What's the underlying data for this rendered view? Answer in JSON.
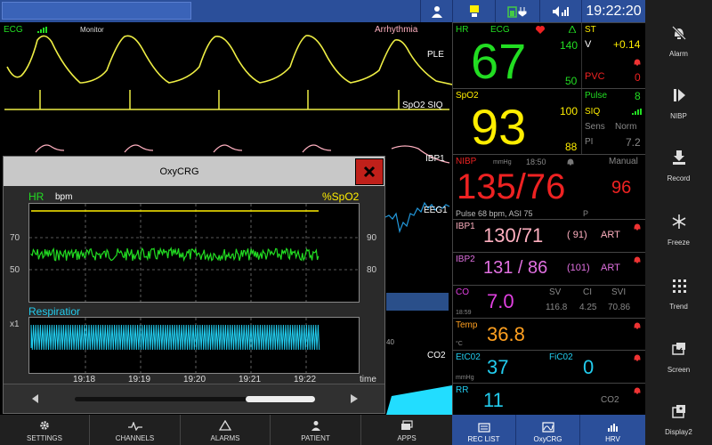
{
  "status": {
    "clock": "19:22:20"
  },
  "waves": {
    "ecg_label": "ECG",
    "monitor_label": "Monitor",
    "arrhythmia_label": "Arrhythmia",
    "ple_label": "PLE",
    "spo2_siq_label": "SpO2 SIQ",
    "ibp1_label": "IBP1",
    "eeg_label": "EEG1",
    "co2_label": "CO2",
    "partial_scale": "40"
  },
  "params": {
    "hr": {
      "label": "HR",
      "source": "ECG",
      "value": "67",
      "upper": "140",
      "lower": "50"
    },
    "st": {
      "label": "ST",
      "lead": "V",
      "value": "+0.14",
      "pvc_label": "PVC",
      "pvc_value": "0"
    },
    "spo2": {
      "label": "SpO2",
      "value": "93",
      "upper": "100",
      "lower": "88",
      "pulse_label": "Pulse",
      "pulse_value": "8",
      "siq_label": "SIQ",
      "sens_label": "Sens",
      "sens_value": "Norm",
      "pi_label": "PI",
      "pi_value": "7.2"
    },
    "nibp": {
      "label": "NIBP",
      "unit": "mmHg",
      "time": "18:50",
      "mode": "Manual",
      "value": "135/76",
      "mean": "96",
      "pulse_line": "Pulse 68 bpm, ASI 75",
      "p_label": "P"
    },
    "ibp1": {
      "label": "IBP1",
      "value": "130/71",
      "mean": "( 91)",
      "site": "ART"
    },
    "ibp2": {
      "label": "IBP2",
      "value": "131 / 86",
      "mean": "(101)",
      "site": "ART"
    },
    "co": {
      "label": "CO",
      "time": "18:59",
      "value": "7.0",
      "sv_label": "SV",
      "sv_value": "116.8",
      "ci_label": "CI",
      "ci_value": "4.25",
      "svi_label": "SVI",
      "svi_value": "70.86"
    },
    "temp": {
      "label": "Temp",
      "unit": "°C",
      "value": "36.8"
    },
    "etco2": {
      "label": "EtC02",
      "unit": "mmHg",
      "value": "37",
      "fico2_label": "FiC02",
      "fico2_value": "0"
    },
    "rr": {
      "label": "RR",
      "value": "11",
      "co2_label": "CO2"
    }
  },
  "popup": {
    "title": "OxyCRG",
    "hr_label": "HR",
    "unit_label": "bpm",
    "spo2_label": "%SpO2",
    "hr_ticks": [
      "70",
      "50"
    ],
    "spo2_ticks": [
      "90",
      "80"
    ],
    "resp_label": "Respiratior",
    "x1_label": "x1",
    "time_ticks": [
      "19:18",
      "19:19",
      "19:20",
      "19:21",
      "19:22"
    ],
    "time_label": "time"
  },
  "sidebar": [
    {
      "name": "alarm",
      "label": "Alarm",
      "icon": "bell-off-icon"
    },
    {
      "name": "nibp",
      "label": "NIBP",
      "icon": "play-bar-icon"
    },
    {
      "name": "record",
      "label": "Record",
      "icon": "download-icon"
    },
    {
      "name": "freeze",
      "label": "Freeze",
      "icon": "snowflake-icon"
    },
    {
      "name": "trend",
      "label": "Trend",
      "icon": "grid-dots-icon"
    },
    {
      "name": "screen",
      "label": "Screen",
      "icon": "screen-icon"
    },
    {
      "name": "display2",
      "label": "Display2",
      "icon": "display-icon"
    }
  ],
  "bottom": [
    {
      "name": "settings",
      "label": "SETTINGS",
      "icon": "gear-icon"
    },
    {
      "name": "channels",
      "label": "CHANNELS",
      "icon": "waveform-icon"
    },
    {
      "name": "alarms",
      "label": "ALARMS",
      "icon": "alarm-triangle-icon"
    },
    {
      "name": "patient",
      "label": "PATIENT",
      "icon": "person-icon"
    },
    {
      "name": "apps",
      "label": "APPS",
      "icon": "apps-icon"
    }
  ],
  "bottom2": [
    {
      "name": "rec-list",
      "label": "REC LIST",
      "icon": "list-icon"
    },
    {
      "name": "oxycrg",
      "label": "OxyCRG",
      "icon": "oxycrg-icon"
    },
    {
      "name": "hrv",
      "label": "HRV",
      "icon": "bars-icon"
    }
  ],
  "colors": {
    "hr": "#22dd22",
    "spo2": "#ffee00",
    "nibp": "#ee2222",
    "ibp1": "#ffb0c0",
    "ibp2": "#e070e0",
    "co": "#e040e0",
    "temp": "#ffa020",
    "etco2": "#22ccee",
    "panel_blue": "#2b4f9a",
    "alarm_red": "#c0201a"
  }
}
